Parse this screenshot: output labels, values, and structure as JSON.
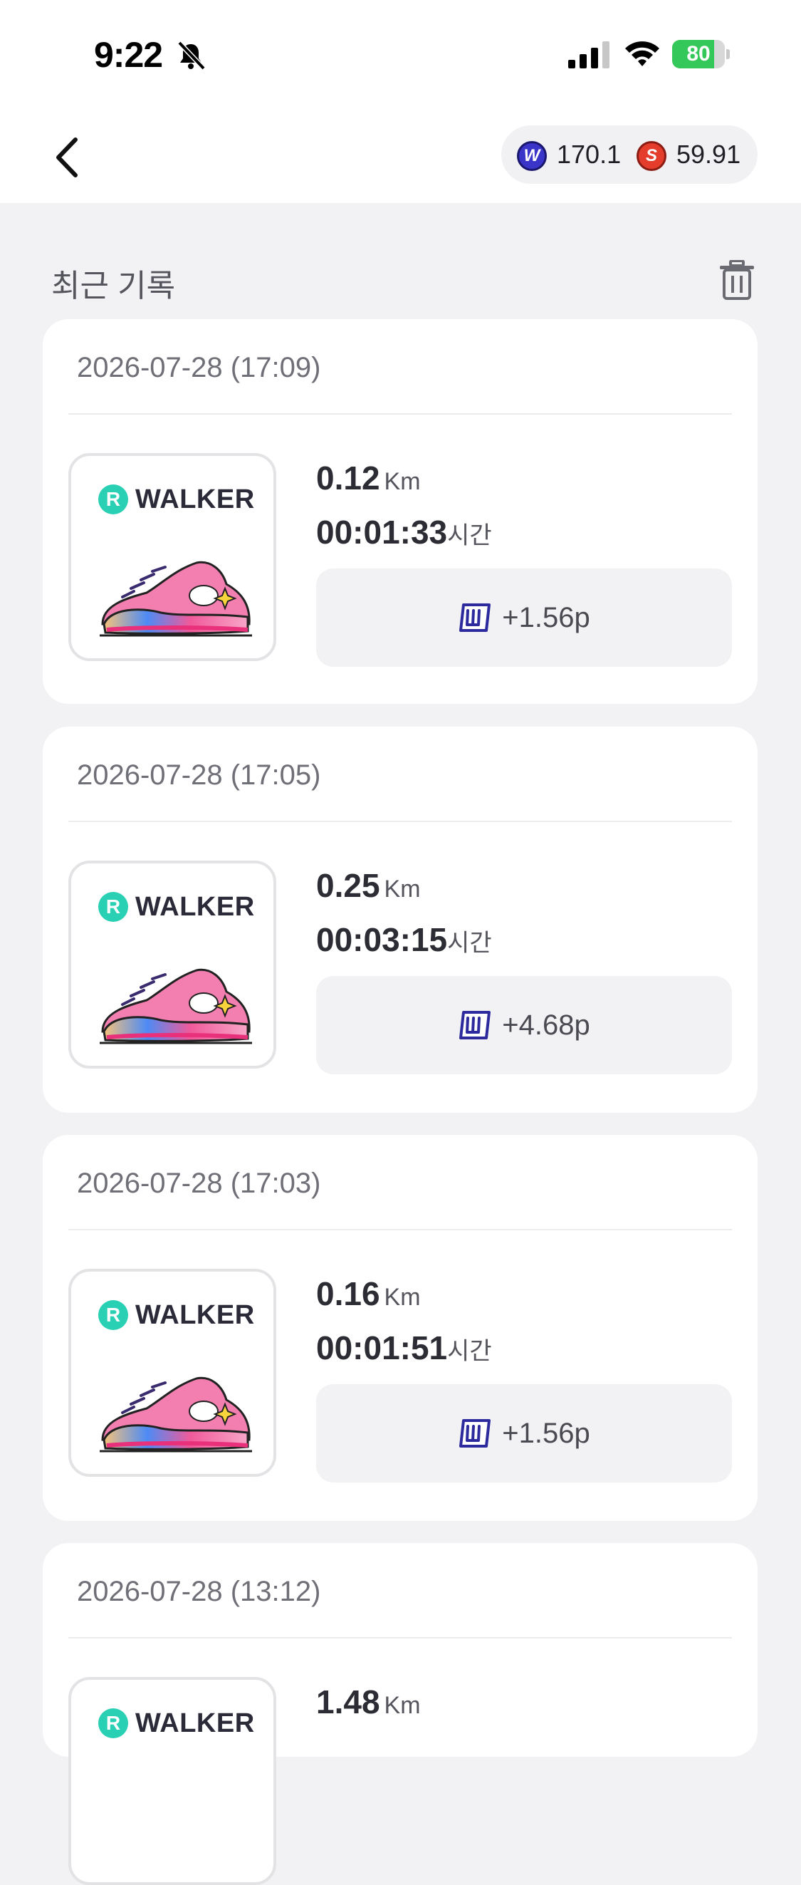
{
  "status_bar": {
    "time": "9:22",
    "battery": "80",
    "battery_level": 0.8,
    "icons": [
      "bell-slash-icon",
      "cellular-signal-icon",
      "wifi-icon",
      "battery-charging-icon"
    ]
  },
  "header": {
    "back_icon": "chevron-left-icon",
    "balances": [
      {
        "icon": "w-coin-icon",
        "coin_letter": "W",
        "value": "170.1",
        "color": "#3a34c9"
      },
      {
        "icon": "s-coin-icon",
        "coin_letter": "S",
        "value": "59.91",
        "color": "#e43d2b"
      }
    ]
  },
  "section": {
    "title": "최근 기록",
    "trash_icon": "trash-icon"
  },
  "records": [
    {
      "date": "2026-07-28 (17:09)",
      "brand": "WALKER",
      "brand_letter": "R",
      "distance": "0.12",
      "distance_unit": "Km",
      "duration": "00:01:33",
      "duration_unit": "시간",
      "reward": "+1.56p"
    },
    {
      "date": "2026-07-28 (17:05)",
      "brand": "WALKER",
      "brand_letter": "R",
      "distance": "0.25",
      "distance_unit": "Km",
      "duration": "00:03:15",
      "duration_unit": "시간",
      "reward": "+4.68p"
    },
    {
      "date": "2026-07-28 (17:03)",
      "brand": "WALKER",
      "brand_letter": "R",
      "distance": "0.16",
      "distance_unit": "Km",
      "duration": "00:01:51",
      "duration_unit": "시간",
      "reward": "+1.56p"
    },
    {
      "date": "2026-07-28 (13:12)",
      "brand": "WALKER",
      "brand_letter": "R",
      "distance": "1.48",
      "distance_unit": "Km"
    }
  ],
  "colors": {
    "accent_teal": "#2ad0b4",
    "shoe_pink": "#f05a9a",
    "reward_icon": "#3a34c9",
    "background": "#f2f2f4"
  }
}
